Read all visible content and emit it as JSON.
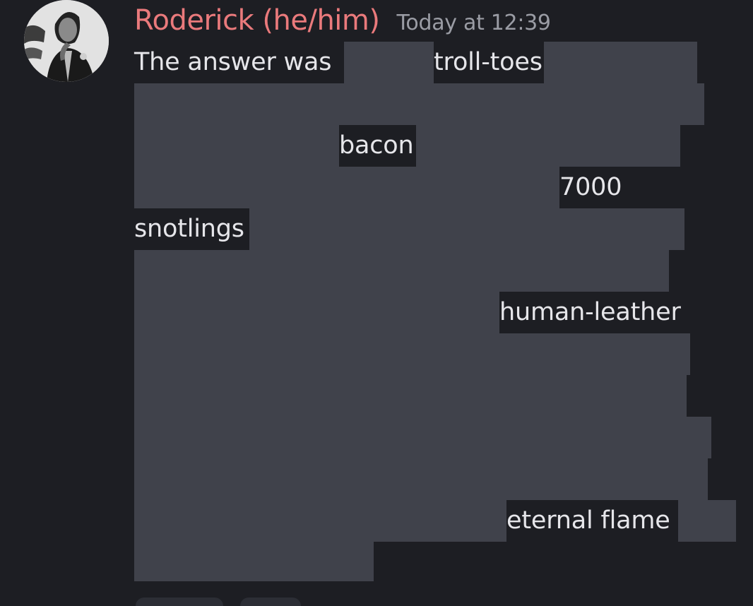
{
  "message": {
    "author": "Roderick (he/him)",
    "timestamp": "Today at 12:39",
    "intro_text": "The answer was",
    "revealed_words": {
      "w1": "troll-toes",
      "w2": "bacon",
      "w3": "7000",
      "w4": "snotlings",
      "w5": "human-leather",
      "w6": "eternal flame"
    }
  },
  "colors": {
    "background": "#1d1e23",
    "spoiler": "#40424b",
    "username": "#ea7a7c",
    "timestamp": "#9a9ca4",
    "text": "#e6e6ea"
  }
}
